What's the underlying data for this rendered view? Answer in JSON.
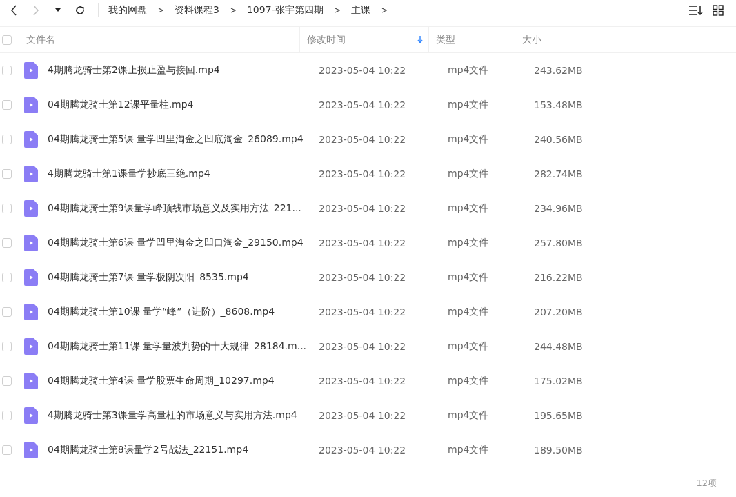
{
  "toolbar": {
    "back_disabled": false,
    "forward_disabled": true,
    "breadcrumb": [
      "我的网盘",
      "资料课程3",
      "1097-张宇第四期",
      "主课"
    ]
  },
  "table": {
    "select_all_checked": false,
    "columns": [
      {
        "label": "文件名",
        "sorted": false
      },
      {
        "label": "修改时间",
        "sorted": true
      },
      {
        "label": "类型",
        "sorted": false
      },
      {
        "label": "大小",
        "sorted": false
      }
    ],
    "rows": [
      {
        "checked": false,
        "name": "4期腾龙骑士第2课止损止盈与接回.mp4",
        "modified": "2023-05-04 10:22",
        "type": "mp4文件",
        "size": "243.62MB"
      },
      {
        "checked": false,
        "name": "04期腾龙骑士第12课平量柱.mp4",
        "modified": "2023-05-04 10:22",
        "type": "mp4文件",
        "size": "153.48MB"
      },
      {
        "checked": false,
        "name": "04期腾龙骑士第5课 量学凹里淘金之凹底淘金_26089.mp4",
        "modified": "2023-05-04 10:22",
        "type": "mp4文件",
        "size": "240.56MB"
      },
      {
        "checked": false,
        "name": "4期腾龙骑士第1课量学抄底三绝.mp4",
        "modified": "2023-05-04 10:22",
        "type": "mp4文件",
        "size": "282.74MB"
      },
      {
        "checked": false,
        "name": "04期腾龙骑士第9课量学峰顶线市场意义及实用方法_221...",
        "modified": "2023-05-04 10:22",
        "type": "mp4文件",
        "size": "234.96MB"
      },
      {
        "checked": false,
        "name": "04期腾龙骑士第6课 量学凹里淘金之凹口淘金_29150.mp4",
        "modified": "2023-05-04 10:22",
        "type": "mp4文件",
        "size": "257.80MB"
      },
      {
        "checked": false,
        "name": "04期腾龙骑士第7课 量学极阴次阳_8535.mp4",
        "modified": "2023-05-04 10:22",
        "type": "mp4文件",
        "size": "216.22MB"
      },
      {
        "checked": false,
        "name": "04期腾龙骑士第10课 量学“峰”（进阶）_8608.mp4",
        "modified": "2023-05-04 10:22",
        "type": "mp4文件",
        "size": "207.20MB"
      },
      {
        "checked": false,
        "name": "04期腾龙骑士第11课 量学量波判势的十大规律_28184.m...",
        "modified": "2023-05-04 10:22",
        "type": "mp4文件",
        "size": "244.48MB"
      },
      {
        "checked": false,
        "name": "04期腾龙骑士第4课 量学股票生命周期_10297.mp4",
        "modified": "2023-05-04 10:22",
        "type": "mp4文件",
        "size": "175.02MB"
      },
      {
        "checked": false,
        "name": "4期腾龙骑士第3课量学高量柱的市场意义与实用方法.mp4",
        "modified": "2023-05-04 10:22",
        "type": "mp4文件",
        "size": "195.65MB"
      },
      {
        "checked": false,
        "name": "04期腾龙骑士第8课量学2号战法_22151.mp4",
        "modified": "2023-05-04 10:22",
        "type": "mp4文件",
        "size": "189.50MB"
      }
    ]
  },
  "status_bar": {
    "count": "12项"
  }
}
